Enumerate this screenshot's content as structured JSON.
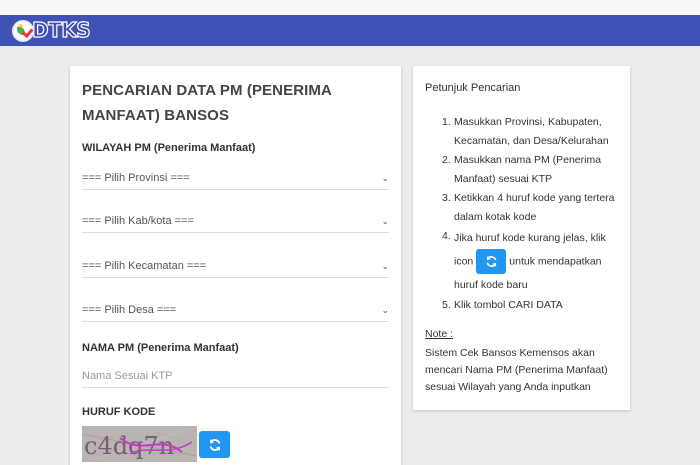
{
  "brand": {
    "logo_text": "DTKS"
  },
  "colors": {
    "navbar": "#3f51b5",
    "accent_button": "#2196f3",
    "page_bg": "#ececec"
  },
  "form": {
    "title": "PENCARIAN DATA PM (PENERIMA MANFAAT) BANSOS",
    "wilayah_label": "WILAYAH PM (Penerima Manfaat)",
    "selects": {
      "provinsi": "=== Pilih Provinsi ===",
      "kabkota": "=== Pilih Kab/kota ===",
      "kecamatan": "=== Pilih Kecamatan ===",
      "desa": "=== Pilih Desa ==="
    },
    "nama_label": "NAMA PM (Penerima Manfaat)",
    "nama_placeholder": "Nama Sesuai KTP",
    "kode_label": "HURUF KODE",
    "captcha_text": "c4dq7n",
    "refresh_icon": "refresh-icon",
    "chevron_icon": "chevron-down-icon"
  },
  "hint": {
    "title": "Petunjuk Pencarian",
    "steps": [
      "Masukkan Provinsi, Kabupaten, Kecamatan, dan Desa/Kelurahan",
      "Masukkan nama PM (Penerima Manfaat) sesuai KTP",
      "Ketikkan 4 huruf kode yang tertera dalam kotak kode",
      {
        "before": "Jika huruf kode kurang jelas, klik icon",
        "after": "untuk mendapatkan huruf kode baru"
      },
      "Klik tombol CARI DATA"
    ],
    "note_label": "Note :",
    "note_text": "Sistem Cek Bansos Kemensos akan mencari Nama PM (Penerima Manfaat) sesuai Wilayah yang Anda inputkan"
  }
}
